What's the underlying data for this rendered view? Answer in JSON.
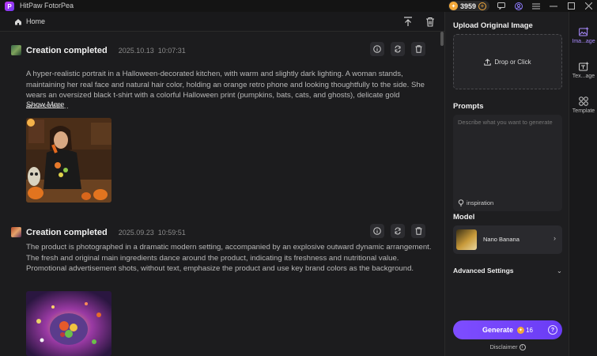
{
  "app": {
    "title": "HitPaw FotorPea",
    "logo_letter": "P"
  },
  "titlebar": {
    "credits": "3959",
    "plus": "+"
  },
  "nav": {
    "home_label": "Home"
  },
  "cards": [
    {
      "title": "Creation completed",
      "date": "2025.10.13",
      "time": "10:07:31",
      "description": "A hyper-realistic portrait in a Halloween-decorated kitchen, with warm and slightly dark lighting. A woman stands, maintaining her real face and natural hair color, holding an orange retro phone and looking thoughtfully to the side. She wears an oversized black t-shirt with a colorful Halloween print (pumpkins, bats, cats, and ghosts), delicate gold accessorie...",
      "show_more": "Show More"
    },
    {
      "title": "Creation completed",
      "date": "2025.09.23",
      "time": "10:59:51",
      "description": "The product is photographed in a dramatic modern setting, accompanied by an explosive outward dynamic arrangement. The fresh and original main ingredients dance around the product, indicating its freshness and nutritional value. Promotional advertisement shots, without text, emphasize the product and use key brand colors as the background."
    }
  ],
  "panel": {
    "upload_heading": "Upload Original Image",
    "upload_label": "Drop or Click",
    "prompts_heading": "Prompts",
    "prompt_placeholder": "Describe what you want to generate",
    "inspiration": "inspiration",
    "model_heading": "Model",
    "model_name": "Nano Banana",
    "advanced": "Advanced Settings",
    "generate": "Generate",
    "generate_cost": "16",
    "disclaimer": "Disclaimer"
  },
  "tabs": [
    {
      "label": "Ima...age",
      "icon": "image-add-icon",
      "active": true
    },
    {
      "label": "Tex...age",
      "icon": "text-image-icon",
      "active": false
    },
    {
      "label": "Template",
      "icon": "template-grid-icon",
      "active": false
    }
  ],
  "colors": {
    "accent": "#7e4dff",
    "coin": "#f3a93a",
    "background": "#1c1c1e"
  }
}
